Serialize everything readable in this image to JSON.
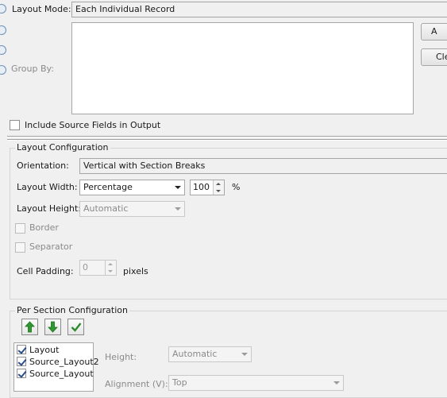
{
  "general": {
    "layout_mode_label": "Layout Mode:",
    "layout_mode_value": "Each Individual Record",
    "group_by_label": "Group By:",
    "add_button_label": "A",
    "clear_button_label": "Cle",
    "include_source_fields_label": "Include Source Fields in Output",
    "include_source_fields_checked": false
  },
  "layout_configuration": {
    "title": "Layout Configuration",
    "orientation_label": "Orientation:",
    "orientation_value": "Vertical with Section Breaks",
    "layout_width_label": "Layout Width:",
    "layout_width_value": "Percentage",
    "width_amount": "100",
    "width_unit": "%",
    "layout_height_label": "Layout Height:",
    "layout_height_value": "Automatic",
    "border_label": "Border",
    "separator_label": "Separator",
    "cell_padding_label": "Cell Padding:",
    "cell_padding_value": "0",
    "cell_padding_unit": "pixels"
  },
  "per_section": {
    "title": "Per Section Configuration",
    "items": [
      {
        "label": "Layout",
        "checked": true
      },
      {
        "label": "Source_Layout2",
        "checked": true
      },
      {
        "label": "Source_Layout",
        "checked": true
      }
    ],
    "height_label": "Height:",
    "height_value": "Automatic",
    "alignment_label": "Alignment (V):",
    "alignment_value": "Top"
  },
  "colors": {
    "arrow_green": "#2e9a2e",
    "check_green": "#2c8a2c"
  },
  "icons": [
    "move-up-icon",
    "move-down-icon",
    "check-all-icon"
  ]
}
